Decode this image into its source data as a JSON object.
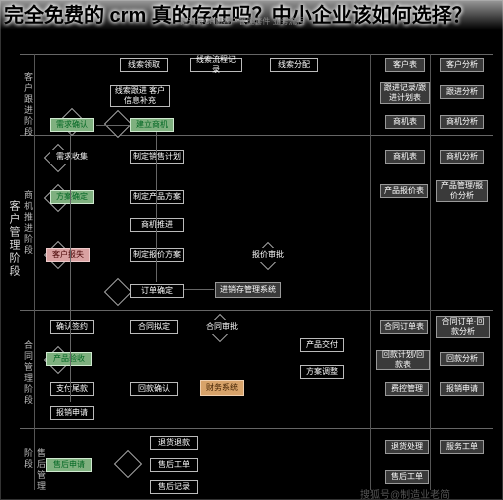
{
  "article": {
    "title": "完全免费的 crm 真的存在吗？中小企业该如何选择？"
  },
  "diagram": {
    "header_hint": "简道云CRM客户管理套件  业务流程",
    "stage_labels": {
      "left_main": "客户管理阶段",
      "s1": "客户跟进阶段",
      "s2": "商机推进阶段",
      "s3": "合同管理阶段",
      "s4": "售后管理阶段"
    },
    "row1": {
      "a": "线索领取",
      "b": "线索流程记录",
      "c": "线索分配",
      "r1": "客户表",
      "r2": "客户分析",
      "r3": "跟进记录/跟进计划表",
      "r4": "跟进分析"
    },
    "row1b": {
      "a": "线索跟进\n客户信息补充"
    },
    "row2": {
      "a": "需求确认",
      "b": "建立商机",
      "r1": "商机表",
      "r2": "商机分析"
    },
    "row3": {
      "a": "需求收集",
      "b": "制定销售计划",
      "r1": "商机表",
      "r2": "商机分析"
    },
    "row4": {
      "a": "方案确定",
      "b": "制定产品方案",
      "r1": "产品报价表",
      "r2": "产品管理/报价分析"
    },
    "row5": {
      "b": "商机推进"
    },
    "row6": {
      "a": "客户报失",
      "b": "制定报价方案",
      "c": "报价审批"
    },
    "row7": {
      "b": "订单确定",
      "c": "进销存管理系统"
    },
    "row8": {
      "a": "确认签约",
      "b": "合同拟定",
      "c": "合同审批",
      "d": "产品交付",
      "r1": "合同订单表",
      "r2": "合同订单·回款分析"
    },
    "row9": {
      "a": "产品验收",
      "r1": "回款计划/回款表",
      "r2": "回款分析"
    },
    "row10": {
      "a": "支付尾款",
      "b": "回款确认",
      "c": "财务系统",
      "d": "方案调整",
      "r1": "费控管理",
      "r2": "报销申请"
    },
    "row11": {
      "a": "报销申请"
    },
    "row12": {
      "b": "退货退款"
    },
    "row13": {
      "a": "售后申请",
      "b": "售后工单",
      "r1": "退货处理",
      "r2": "服务工单"
    },
    "row14": {
      "b": "售后记录",
      "r1": "售后工单"
    }
  },
  "footer": "搜狐号@制造业老简"
}
